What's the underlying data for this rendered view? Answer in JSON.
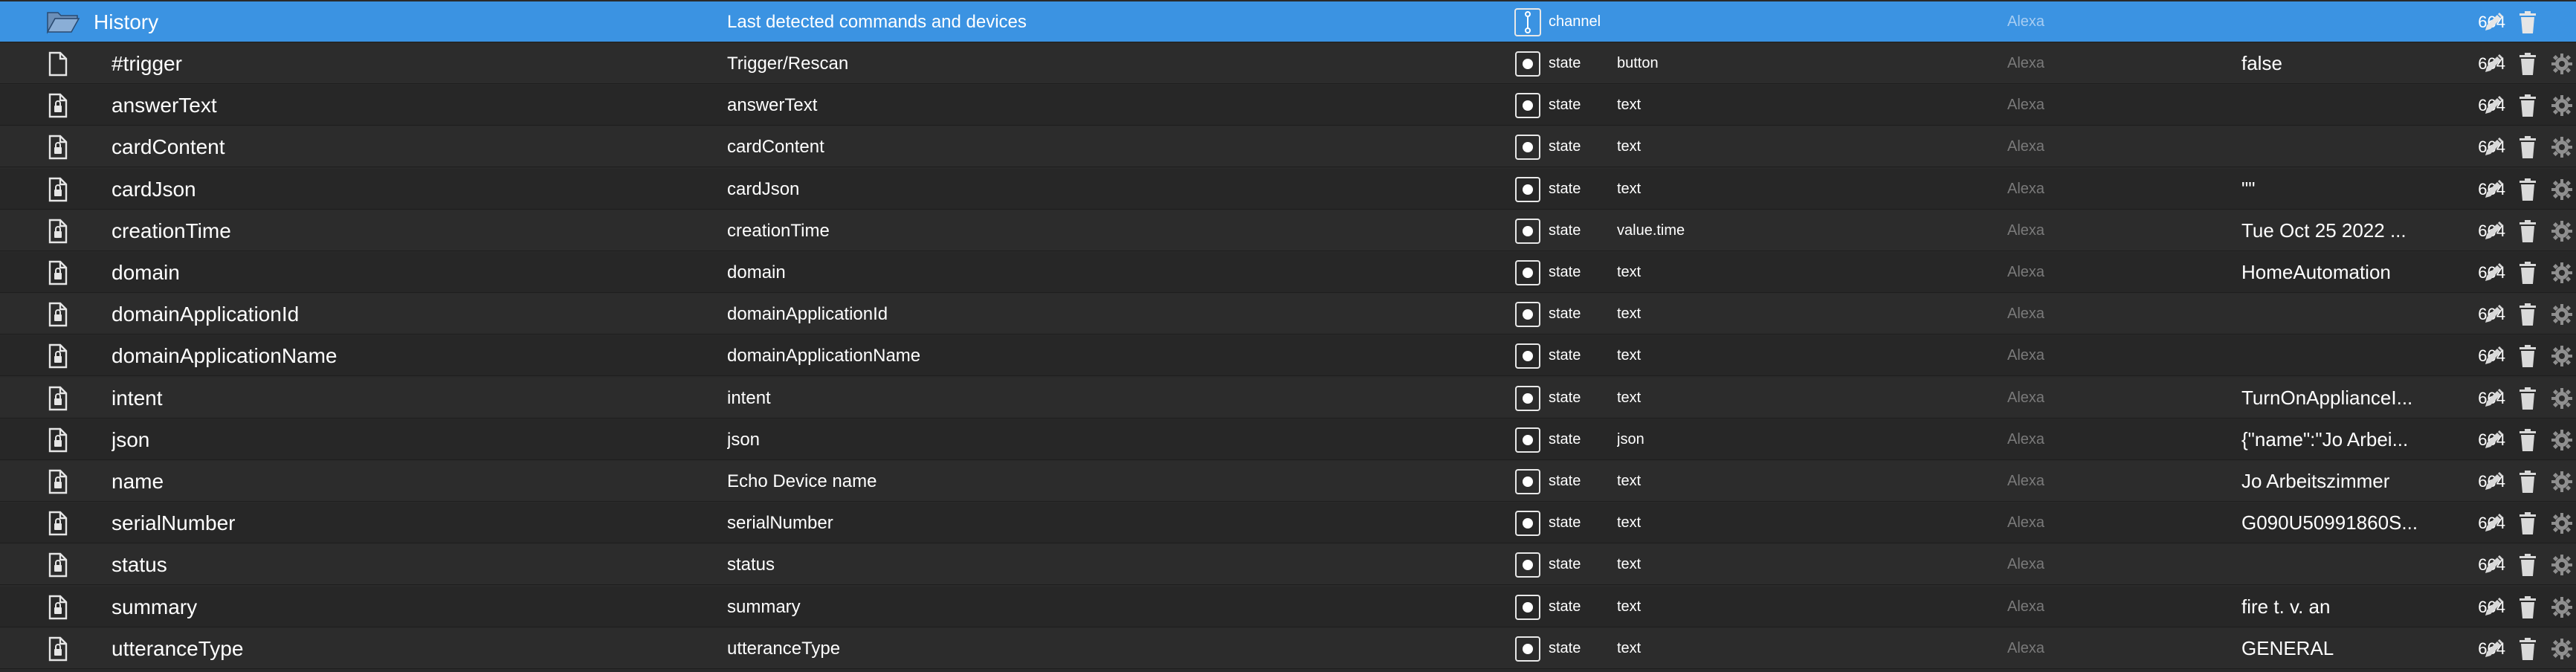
{
  "colors": {
    "header_bg": "#3b93e2",
    "row_bg": "#2c2c2c",
    "text": "#ffffff",
    "muted": "#7a7a7a"
  },
  "header": {
    "id": "History",
    "name": "Last detected commands and devices",
    "type": "channel",
    "room": "Alexa",
    "perm": "664",
    "icon": "folder-open-icon"
  },
  "rows": [
    {
      "id": "#trigger",
      "name": "Trigger/Rescan",
      "type": "state",
      "role": "button",
      "room": "Alexa",
      "value": "false",
      "perm": "664",
      "icon": "file-icon"
    },
    {
      "id": "answerText",
      "name": "answerText",
      "type": "state",
      "role": "text",
      "room": "Alexa",
      "value": "",
      "perm": "664",
      "icon": "file-lock-icon"
    },
    {
      "id": "cardContent",
      "name": "cardContent",
      "type": "state",
      "role": "text",
      "room": "Alexa",
      "value": "",
      "perm": "664",
      "icon": "file-lock-icon"
    },
    {
      "id": "cardJson",
      "name": "cardJson",
      "type": "state",
      "role": "text",
      "room": "Alexa",
      "value": "\"\"",
      "perm": "664",
      "icon": "file-lock-icon"
    },
    {
      "id": "creationTime",
      "name": "creationTime",
      "type": "state",
      "role": "value.time",
      "room": "Alexa",
      "value": "Tue Oct 25 2022 ...",
      "perm": "664",
      "icon": "file-lock-icon"
    },
    {
      "id": "domain",
      "name": "domain",
      "type": "state",
      "role": "text",
      "room": "Alexa",
      "value": "HomeAutomation",
      "perm": "664",
      "icon": "file-lock-icon"
    },
    {
      "id": "domainApplicationId",
      "name": "domainApplicationId",
      "type": "state",
      "role": "text",
      "room": "Alexa",
      "value": "",
      "perm": "664",
      "icon": "file-lock-icon"
    },
    {
      "id": "domainApplicationName",
      "name": "domainApplicationName",
      "type": "state",
      "role": "text",
      "room": "Alexa",
      "value": "",
      "perm": "664",
      "icon": "file-lock-icon"
    },
    {
      "id": "intent",
      "name": "intent",
      "type": "state",
      "role": "text",
      "room": "Alexa",
      "value": "TurnOnApplianceI...",
      "perm": "664",
      "icon": "file-lock-icon"
    },
    {
      "id": "json",
      "name": "json",
      "type": "state",
      "role": "json",
      "room": "Alexa",
      "value": "{\"name\":\"Jo Arbei...",
      "perm": "664",
      "icon": "file-lock-icon"
    },
    {
      "id": "name",
      "name": "Echo Device name",
      "type": "state",
      "role": "text",
      "room": "Alexa",
      "value": "Jo Arbeitszimmer",
      "perm": "664",
      "icon": "file-lock-icon"
    },
    {
      "id": "serialNumber",
      "name": "serialNumber",
      "type": "state",
      "role": "text",
      "room": "Alexa",
      "value": "G090U50991860S...",
      "perm": "664",
      "icon": "file-lock-icon"
    },
    {
      "id": "status",
      "name": "status",
      "type": "state",
      "role": "text",
      "room": "Alexa",
      "value": "",
      "perm": "664",
      "icon": "file-lock-icon"
    },
    {
      "id": "summary",
      "name": "summary",
      "type": "state",
      "role": "text",
      "room": "Alexa",
      "value": "fire t. v. an",
      "perm": "664",
      "icon": "file-lock-icon"
    },
    {
      "id": "utteranceType",
      "name": "utteranceType",
      "type": "state",
      "role": "text",
      "room": "Alexa",
      "value": "GENERAL",
      "perm": "664",
      "icon": "file-lock-icon"
    }
  ]
}
